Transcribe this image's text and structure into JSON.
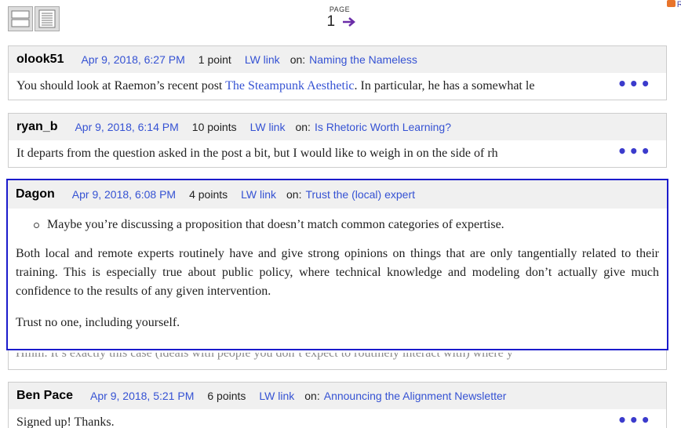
{
  "toolbar": {
    "view_buttons": [
      "compact-view-icon",
      "expanded-view-icon"
    ]
  },
  "pager": {
    "label": "PAGE",
    "current": "1"
  },
  "rss": {
    "label": "RS"
  },
  "comments": [
    {
      "author": "olook51",
      "date": "Apr 9, 2018, 6:27 PM",
      "points": "1 point",
      "lw_link": "LW link",
      "on": "on:",
      "post": "Naming the Nameless",
      "body_pre": "You should look at Raemon’s recent post ",
      "body_link": "The Steampunk Aesthetic",
      "body_post": ". In particular, he has a somewhat le",
      "more": "•••"
    },
    {
      "author": "ryan_b",
      "date": "Apr 9, 2018, 6:14 PM",
      "points": "10 points",
      "lw_link": "LW link",
      "on": "on:",
      "post": "Is Rhetoric Worth Learning?",
      "body": "It departs from the question asked in the post a bit, but I would like to weigh in on the side of rh",
      "more": "•••"
    },
    {
      "author": "Dagon",
      "date": "Apr 9, 2018, 6:08 PM",
      "points": "4 points",
      "lw_link": "LW link",
      "on": "on:",
      "post": "Trust the (local) expert",
      "bullet": "Maybe you’re discussing a proposition that doesn’t match common categories of expertise.",
      "para1": "Both local and remote experts routinely have and give strong opinions on things that are only tangentially related to their training. This is especially true about public policy, where technical knowledge and modeling don’t actually give much confidence to the results of any given intervention.",
      "para2": "Trust no one, including yourself."
    },
    {
      "ghost_text": "Hmm. It’s exactly this case (ideals with people you don’t expect to routinely interact with) where y"
    },
    {
      "author": "Ben Pace",
      "date": "Apr 9, 2018, 5:21 PM",
      "points": "6 points",
      "lw_link": "LW link",
      "on": "on:",
      "post": "Announcing the Alignment Newsletter",
      "body": "Signed up! Thanks.",
      "more": "•••"
    }
  ],
  "colors": {
    "link": "#3552d3",
    "highlight_border": "#1b1bcc",
    "header_bg": "#f0f0f0"
  }
}
